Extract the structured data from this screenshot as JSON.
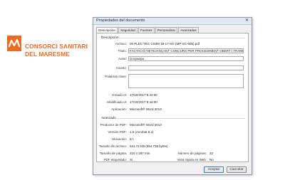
{
  "logo": {
    "line1": "CONSORCI SANITARI",
    "line2": "DEL MARESME",
    "color": "#ec6b22"
  },
  "dialog": {
    "title": "Propiedades del documento",
    "close_label": "✕",
    "tabs": [
      "Descripción",
      "Seguridad",
      "Fuentes",
      "Personalizar",
      "Avanzadas"
    ],
    "description": {
      "section_label": "Descripción",
      "file_label": "Archivo:",
      "file_value": "05 PLEC TEC CSdM 18-17-SG (MP-SC-006).pdf",
      "title_label": "Título:",
      "title_value": "FACTACIÓ NETEJANÇANT CONCURS PER PROCEDIMENT OBERT I TRAMIT ORDINARI DE L",
      "author_label": "Autor:",
      "author_value": "Grupaepa",
      "subject_label": "Asunto:",
      "subject_value": "",
      "keywords_label": "Palabras clave:",
      "keywords_value": "",
      "created_label": "Creado el:",
      "created_value": "17/10/2017 8:44:00",
      "modified_label": "Modificado el:",
      "modified_value": "17/10/2017 8:44:00",
      "application_label": "Aplicación:",
      "application_value": "Microsoft® Word 2013"
    },
    "advanced": {
      "section_label": "Avanzado",
      "producer_label": "Productor de PDF:",
      "producer_value": "Microsoft® Word 2013",
      "version_label": "Versión PDF:",
      "version_value": "1.5 (Acrobat 6.x)",
      "location_label": "Ubicación:",
      "location_value": "E:\\",
      "filesize_label": "Tamaño de archivo:",
      "filesize_value": "541,74 KB (554.738 bytes)",
      "pagesize_label": "Tamaño de página:",
      "pagesize_value": "210 x 297 mm",
      "pagecount_label": "Número de páginas:",
      "pagecount_value": "32",
      "tagged_label": "PDF etiquetado:",
      "tagged_value": "Sí",
      "fastweb_label": "Vista rápida en Web:",
      "fastweb_value": "No"
    },
    "buttons": {
      "ok": "Aceptar",
      "cancel": "Cancelar"
    }
  }
}
